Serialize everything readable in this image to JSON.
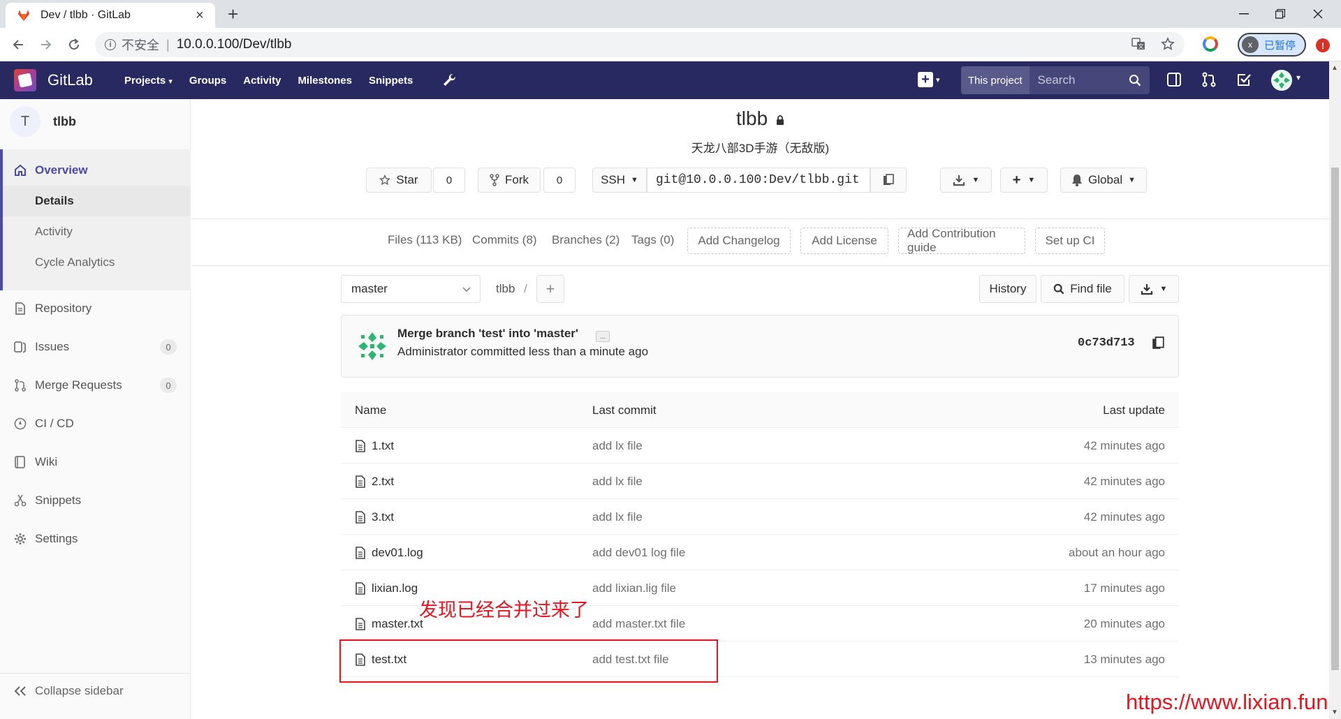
{
  "browser": {
    "tab_title": "Dev / tlbb · GitLab",
    "security_label": "不安全",
    "url": "10.0.0.100/Dev/tlbb",
    "profile_initial": "x",
    "profile_label": "已暂停",
    "update_badge": "!"
  },
  "gitlab_nav": {
    "brand": "GitLab",
    "menu": [
      "Projects",
      "Groups",
      "Activity",
      "Milestones",
      "Snippets"
    ],
    "search_scope": "This project",
    "search_placeholder": "Search",
    "colors": {
      "navbar": "#292961",
      "accent": "#4b4ba3"
    }
  },
  "sidebar": {
    "project_initial": "T",
    "project_name": "tlbb",
    "overview": "Overview",
    "overview_sub": [
      "Details",
      "Activity",
      "Cycle Analytics"
    ],
    "items": [
      {
        "label": "Repository",
        "icon": "document-icon"
      },
      {
        "label": "Issues",
        "icon": "issues-icon",
        "count": "0"
      },
      {
        "label": "Merge Requests",
        "icon": "merge-request-icon",
        "count": "0"
      },
      {
        "label": "CI / CD",
        "icon": "rocket-icon"
      },
      {
        "label": "Wiki",
        "icon": "book-icon"
      },
      {
        "label": "Snippets",
        "icon": "scissors-icon"
      },
      {
        "label": "Settings",
        "icon": "gear-icon"
      }
    ],
    "collapse": "Collapse sidebar"
  },
  "project": {
    "title": "tlbb",
    "description": "天龙八部3D手游（无敌版)",
    "star_label": "Star",
    "star_count": "0",
    "fork_label": "Fork",
    "fork_count": "0",
    "protocol": "SSH",
    "clone_url": "git@10.0.0.100:Dev/tlbb.git",
    "notification": "Global"
  },
  "stats": {
    "files": "Files (113 KB)",
    "commits": "Commits (8)",
    "branches": "Branches (2)",
    "tags": "Tags (0)",
    "add_changelog": "Add Changelog",
    "add_license": "Add License",
    "add_contribution": "Add Contribution guide",
    "setup_ci": "Set up CI"
  },
  "tree": {
    "branch": "master",
    "breadcrumb": "tlbb",
    "breadcrumb_sep": "/",
    "history": "History",
    "find_file": "Find file"
  },
  "last_commit": {
    "title": "Merge branch 'test' into 'master'",
    "more": "...",
    "meta": "Administrator committed less than a minute ago",
    "sha": "0c73d713"
  },
  "file_table": {
    "headers": {
      "name": "Name",
      "last_commit": "Last commit",
      "last_update": "Last update"
    },
    "rows": [
      {
        "name": "1.txt",
        "commit": "add lx file",
        "updated": "42 minutes ago"
      },
      {
        "name": "2.txt",
        "commit": "add lx file",
        "updated": "42 minutes ago"
      },
      {
        "name": "3.txt",
        "commit": "add lx file",
        "updated": "42 minutes ago"
      },
      {
        "name": "dev01.log",
        "commit": "add dev01 log file",
        "updated": "about an hour ago"
      },
      {
        "name": "lixian.log",
        "commit": "add lixian.lig file",
        "updated": "17 minutes ago"
      },
      {
        "name": "master.txt",
        "commit": "add master.txt file",
        "updated": "20 minutes ago"
      },
      {
        "name": "test.txt",
        "commit": "add test.txt file",
        "updated": "13 minutes ago"
      }
    ]
  },
  "annotation": {
    "note": "发现已经合并过来了",
    "watermark": "https://www.lixian.fun",
    "color": "#e8141e"
  }
}
